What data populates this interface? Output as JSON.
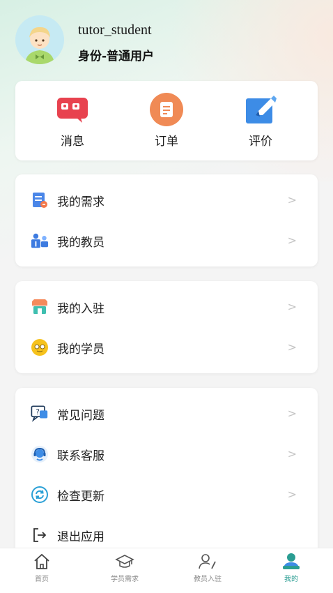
{
  "profile": {
    "username": "tutor_student",
    "role": "身份-普通用户"
  },
  "quick_actions": [
    {
      "label": "消息",
      "icon": "message-icon",
      "color": "#e8424f"
    },
    {
      "label": "订单",
      "icon": "order-icon",
      "color": "#f08a55"
    },
    {
      "label": "评价",
      "icon": "review-icon",
      "color": "#3d8ce6"
    }
  ],
  "menu_groups": [
    [
      {
        "label": "我的需求",
        "icon": "requirements-icon"
      },
      {
        "label": "我的教员",
        "icon": "tutors-icon"
      }
    ],
    [
      {
        "label": "我的入驻",
        "icon": "store-icon"
      },
      {
        "label": "我的学员",
        "icon": "student-icon"
      }
    ],
    [
      {
        "label": "常见问题",
        "icon": "faq-icon"
      },
      {
        "label": "联系客服",
        "icon": "customer-service-icon"
      },
      {
        "label": "检查更新",
        "icon": "refresh-icon"
      },
      {
        "label": "退出应用",
        "icon": "logout-icon"
      }
    ]
  ],
  "chevron": ">",
  "tabbar": [
    {
      "label": "首页",
      "icon": "home-icon",
      "active": false
    },
    {
      "label": "学员需求",
      "icon": "graduation-cap-icon",
      "active": false
    },
    {
      "label": "教员入驻",
      "icon": "tutor-join-icon",
      "active": false
    },
    {
      "label": "我的",
      "icon": "profile-icon",
      "active": true
    }
  ],
  "colors": {
    "accent": "#2a9d92",
    "inactive_tab": "#8a8a8a",
    "chevron": "#c4c4c4"
  }
}
